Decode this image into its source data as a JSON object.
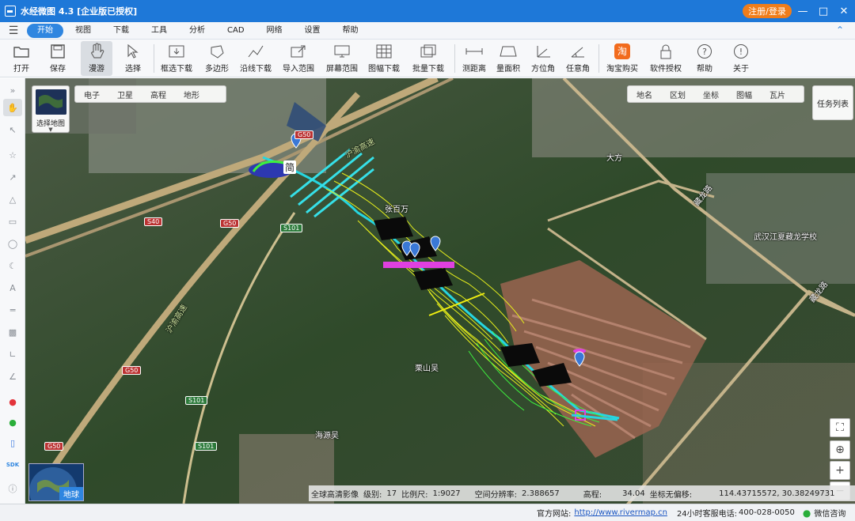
{
  "app": {
    "title": "水经微图 4.3 [企业版已授权]",
    "login_label": "注册/登录",
    "win_controls": [
      "minimize-icon",
      "maximize-icon",
      "close-icon"
    ]
  },
  "menu": {
    "items": [
      {
        "label": "开始",
        "active": true
      },
      {
        "label": "视图"
      },
      {
        "label": "下载"
      },
      {
        "label": "工具"
      },
      {
        "label": "分析"
      },
      {
        "label": "CAD"
      },
      {
        "label": "网络"
      },
      {
        "label": "设置"
      },
      {
        "label": "帮助"
      }
    ]
  },
  "toolbar": {
    "tools": [
      {
        "label": "打开",
        "icon": "folder-icon"
      },
      {
        "label": "保存",
        "icon": "save-icon"
      },
      {
        "label": "漫游",
        "icon": "hand-icon",
        "selected": true
      },
      {
        "label": "选择",
        "icon": "cursor-icon"
      },
      {
        "label": "框选下载",
        "icon": "box-download-icon"
      },
      {
        "label": "多边形",
        "icon": "polygon-download-icon"
      },
      {
        "label": "沿线下载",
        "icon": "line-download-icon"
      },
      {
        "label": "导入范围",
        "icon": "import-range-icon"
      },
      {
        "label": "屏幕范围",
        "icon": "screen-range-icon"
      },
      {
        "label": "图幅下载",
        "icon": "sheet-download-icon"
      },
      {
        "label": "批量下载",
        "icon": "batch-download-icon"
      },
      {
        "label": "测距离",
        "icon": "measure-distance-icon"
      },
      {
        "label": "量面积",
        "icon": "measure-area-icon"
      },
      {
        "label": "方位角",
        "icon": "azimuth-icon"
      },
      {
        "label": "任意角",
        "icon": "angle-icon"
      },
      {
        "label": "淘宝购买",
        "icon": "taobao-icon"
      },
      {
        "label": "软件授权",
        "icon": "lock-icon"
      },
      {
        "label": "帮助",
        "icon": "help-icon"
      },
      {
        "label": "关于",
        "icon": "info-icon"
      }
    ]
  },
  "map": {
    "switch_label": "选择地图",
    "type_tabs": [
      "电子",
      "卫星",
      "高程",
      "地形"
    ],
    "overlay_tabs": [
      "地名",
      "区划",
      "坐标",
      "图幅",
      "瓦片"
    ],
    "task_list_label": "任务列表",
    "globe_label": "地球",
    "place_labels": [
      "张百万",
      "栗山吴",
      "海源吴",
      "大方",
      "武汉江夏藏龙学校"
    ],
    "marker_char": "简",
    "road_labels": [
      "G50",
      "S40",
      "S101",
      "沪渝高速",
      "藏龙路"
    ]
  },
  "info_bar": {
    "source": "全球高清影像",
    "level_label": "级别:",
    "level": "17",
    "scale_label": "比例尺:",
    "scale": "1:9027",
    "resolution_label": "空间分辨率:",
    "resolution": "2.388657",
    "elevation_label": "高程:",
    "elevation": "34.04",
    "coord_label": "坐标无偏移:",
    "coords": "114.43715572, 30.38249731"
  },
  "status": {
    "website_label": "官方网站:",
    "website": "http://www.rivermap.cn",
    "hotline_label": "24小时客服电话:",
    "hotline": "400-028-0050",
    "wechat_label": "微信咨询"
  },
  "colors": {
    "titlebar": "#1e78d8",
    "accent": "#2f86e0",
    "login": "#f07d1a",
    "contour_yellow": "#e6ee1c",
    "contour_green": "#3ef03e",
    "cyan": "#26d6e0",
    "magenta": "#e040e0"
  }
}
